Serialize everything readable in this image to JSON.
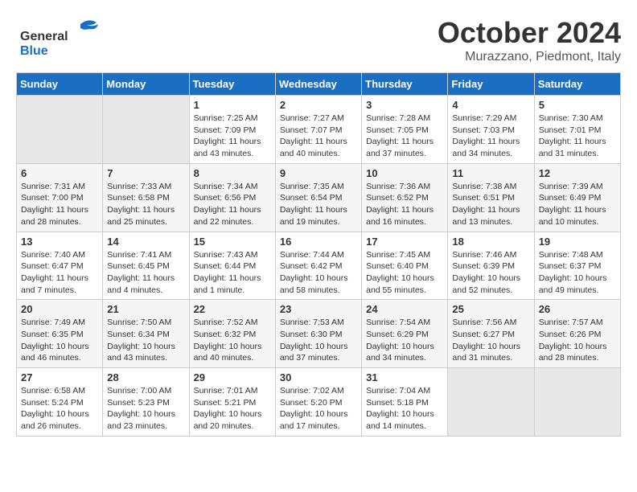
{
  "header": {
    "logo_general": "General",
    "logo_blue": "Blue",
    "month_title": "October 2024",
    "location": "Murazzano, Piedmont, Italy"
  },
  "weekdays": [
    "Sunday",
    "Monday",
    "Tuesday",
    "Wednesday",
    "Thursday",
    "Friday",
    "Saturday"
  ],
  "weeks": [
    [
      {
        "day": "",
        "info": ""
      },
      {
        "day": "",
        "info": ""
      },
      {
        "day": "1",
        "info": "Sunrise: 7:25 AM\nSunset: 7:09 PM\nDaylight: 11 hours and 43 minutes."
      },
      {
        "day": "2",
        "info": "Sunrise: 7:27 AM\nSunset: 7:07 PM\nDaylight: 11 hours and 40 minutes."
      },
      {
        "day": "3",
        "info": "Sunrise: 7:28 AM\nSunset: 7:05 PM\nDaylight: 11 hours and 37 minutes."
      },
      {
        "day": "4",
        "info": "Sunrise: 7:29 AM\nSunset: 7:03 PM\nDaylight: 11 hours and 34 minutes."
      },
      {
        "day": "5",
        "info": "Sunrise: 7:30 AM\nSunset: 7:01 PM\nDaylight: 11 hours and 31 minutes."
      }
    ],
    [
      {
        "day": "6",
        "info": "Sunrise: 7:31 AM\nSunset: 7:00 PM\nDaylight: 11 hours and 28 minutes."
      },
      {
        "day": "7",
        "info": "Sunrise: 7:33 AM\nSunset: 6:58 PM\nDaylight: 11 hours and 25 minutes."
      },
      {
        "day": "8",
        "info": "Sunrise: 7:34 AM\nSunset: 6:56 PM\nDaylight: 11 hours and 22 minutes."
      },
      {
        "day": "9",
        "info": "Sunrise: 7:35 AM\nSunset: 6:54 PM\nDaylight: 11 hours and 19 minutes."
      },
      {
        "day": "10",
        "info": "Sunrise: 7:36 AM\nSunset: 6:52 PM\nDaylight: 11 hours and 16 minutes."
      },
      {
        "day": "11",
        "info": "Sunrise: 7:38 AM\nSunset: 6:51 PM\nDaylight: 11 hours and 13 minutes."
      },
      {
        "day": "12",
        "info": "Sunrise: 7:39 AM\nSunset: 6:49 PM\nDaylight: 11 hours and 10 minutes."
      }
    ],
    [
      {
        "day": "13",
        "info": "Sunrise: 7:40 AM\nSunset: 6:47 PM\nDaylight: 11 hours and 7 minutes."
      },
      {
        "day": "14",
        "info": "Sunrise: 7:41 AM\nSunset: 6:45 PM\nDaylight: 11 hours and 4 minutes."
      },
      {
        "day": "15",
        "info": "Sunrise: 7:43 AM\nSunset: 6:44 PM\nDaylight: 11 hours and 1 minute."
      },
      {
        "day": "16",
        "info": "Sunrise: 7:44 AM\nSunset: 6:42 PM\nDaylight: 10 hours and 58 minutes."
      },
      {
        "day": "17",
        "info": "Sunrise: 7:45 AM\nSunset: 6:40 PM\nDaylight: 10 hours and 55 minutes."
      },
      {
        "day": "18",
        "info": "Sunrise: 7:46 AM\nSunset: 6:39 PM\nDaylight: 10 hours and 52 minutes."
      },
      {
        "day": "19",
        "info": "Sunrise: 7:48 AM\nSunset: 6:37 PM\nDaylight: 10 hours and 49 minutes."
      }
    ],
    [
      {
        "day": "20",
        "info": "Sunrise: 7:49 AM\nSunset: 6:35 PM\nDaylight: 10 hours and 46 minutes."
      },
      {
        "day": "21",
        "info": "Sunrise: 7:50 AM\nSunset: 6:34 PM\nDaylight: 10 hours and 43 minutes."
      },
      {
        "day": "22",
        "info": "Sunrise: 7:52 AM\nSunset: 6:32 PM\nDaylight: 10 hours and 40 minutes."
      },
      {
        "day": "23",
        "info": "Sunrise: 7:53 AM\nSunset: 6:30 PM\nDaylight: 10 hours and 37 minutes."
      },
      {
        "day": "24",
        "info": "Sunrise: 7:54 AM\nSunset: 6:29 PM\nDaylight: 10 hours and 34 minutes."
      },
      {
        "day": "25",
        "info": "Sunrise: 7:56 AM\nSunset: 6:27 PM\nDaylight: 10 hours and 31 minutes."
      },
      {
        "day": "26",
        "info": "Sunrise: 7:57 AM\nSunset: 6:26 PM\nDaylight: 10 hours and 28 minutes."
      }
    ],
    [
      {
        "day": "27",
        "info": "Sunrise: 6:58 AM\nSunset: 5:24 PM\nDaylight: 10 hours and 26 minutes."
      },
      {
        "day": "28",
        "info": "Sunrise: 7:00 AM\nSunset: 5:23 PM\nDaylight: 10 hours and 23 minutes."
      },
      {
        "day": "29",
        "info": "Sunrise: 7:01 AM\nSunset: 5:21 PM\nDaylight: 10 hours and 20 minutes."
      },
      {
        "day": "30",
        "info": "Sunrise: 7:02 AM\nSunset: 5:20 PM\nDaylight: 10 hours and 17 minutes."
      },
      {
        "day": "31",
        "info": "Sunrise: 7:04 AM\nSunset: 5:18 PM\nDaylight: 10 hours and 14 minutes."
      },
      {
        "day": "",
        "info": ""
      },
      {
        "day": "",
        "info": ""
      }
    ]
  ]
}
